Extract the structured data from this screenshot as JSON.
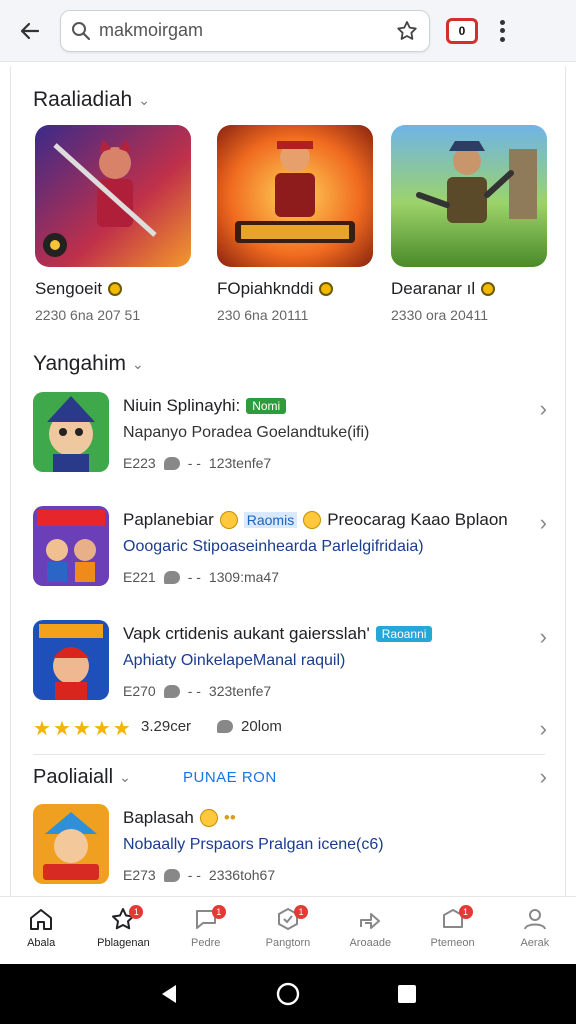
{
  "toolbar": {
    "search_text": "makmoirgam",
    "tab_count": "0"
  },
  "section1": {
    "title": "Raaliadiah",
    "cards": [
      {
        "name": "Sengoeit",
        "meta": "2230 6na 207 51"
      },
      {
        "name": "FOpiahknddi",
        "meta": "230 6na 20111"
      },
      {
        "name": "Dearanar ıl",
        "meta": "2330 ora 20411"
      }
    ]
  },
  "section2": {
    "title": "Yangahim",
    "rows": [
      {
        "title": "Niuin Splinayhi:",
        "badge": "Nomi",
        "sub": "Napanyo Poradea Goelandtuke(ifi)",
        "meta_code": "E223",
        "meta_dots": "- -",
        "meta_value": "123tenfe7"
      },
      {
        "title_a": "Paplanebiar",
        "badge": "Raomis",
        "title_b": "Preocarag Kaao Bplaon",
        "sub": "Ooogaric Stipoaseinhearda Parlelgifridaia)",
        "meta_code": "E221",
        "meta_dots": "- -",
        "meta_value": "1309:ma47"
      },
      {
        "title": "Vapk crtidenis aukant gaiersslah'",
        "badge": "Raoanni",
        "sub": "Aphiaty OinkelapeManal raquil)",
        "meta_code": "E270",
        "meta_dots": "- -",
        "meta_value": "323tenfe7"
      }
    ],
    "rating": {
      "stars": 5,
      "score": "3.29cer",
      "count": "20lom"
    }
  },
  "section3": {
    "title": "Paoliaiall",
    "tag": "PUNAE RON",
    "row": {
      "title": "Baplasah",
      "sub": "Nobaally Prspaors Pralgan icene(c6)",
      "meta_code": "E273",
      "meta_dots": "- -",
      "meta_value": "2336toh67"
    }
  },
  "bottom_nav": [
    {
      "label": "Abala",
      "icon": "home-icon",
      "badge": ""
    },
    {
      "label": "Pblagenan",
      "icon": "star-icon",
      "badge": "1"
    },
    {
      "label": "Pedre",
      "icon": "chat-icon",
      "badge": "1"
    },
    {
      "label": "Pangtorn",
      "icon": "badge-icon",
      "badge": "1"
    },
    {
      "label": "Aroaade",
      "icon": "share-icon",
      "badge": ""
    },
    {
      "label": "Ptemeon",
      "icon": "inbox-icon",
      "badge": "1"
    },
    {
      "label": "Aerak",
      "icon": "person-icon",
      "badge": ""
    }
  ],
  "colors": {
    "accent": "#1a73e8",
    "badge_red": "#e53935",
    "badge_green": "#2e9b3e",
    "star": "#f4b400"
  }
}
